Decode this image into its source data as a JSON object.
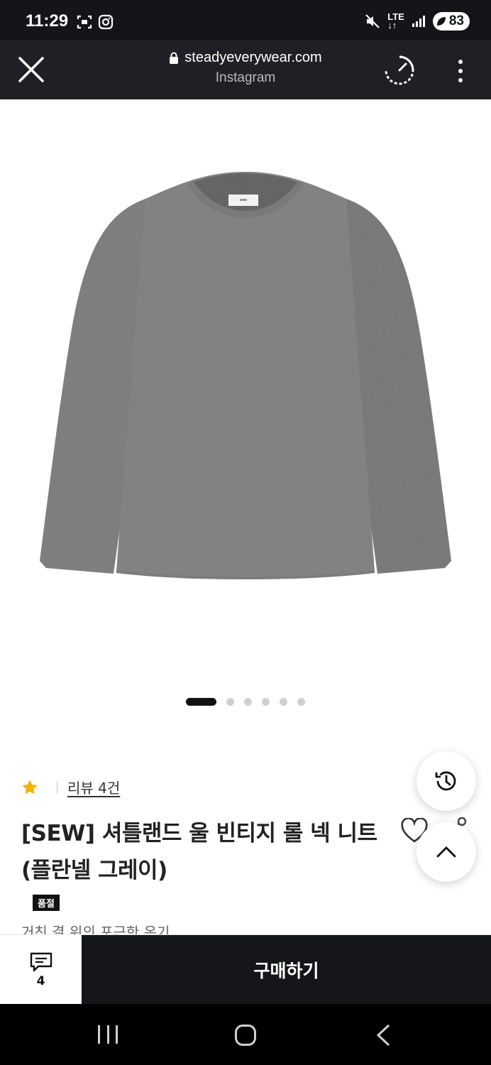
{
  "status_bar": {
    "time": "11:29",
    "network": "LTE",
    "battery": "83"
  },
  "browser": {
    "url": "steadyeverywear.com",
    "source": "Instagram"
  },
  "carousel": {
    "total": 6,
    "active_index": 0
  },
  "product": {
    "rating_stars": 1,
    "review_link": "리뷰 4건",
    "title": "[SEW] 셔틀랜드 울 빈티지 롤 넥 니트 (플란넬 그레이)",
    "badge": "품절",
    "subtext": "거친 결 위의 포근한 온기"
  },
  "bottom_bar": {
    "comment_count": "4",
    "buy_label": "구매하기"
  },
  "icons": {
    "close": "close-icon",
    "lock": "lock-icon",
    "speed": "speed-icon",
    "menu": "more-vert-icon",
    "star": "star-icon",
    "heart": "heart-icon",
    "share": "share-icon",
    "history": "history-icon",
    "up": "chevron-up-icon",
    "comment": "comment-icon"
  },
  "colors": {
    "star": "#f5b301",
    "buy_button": "#15161a",
    "status_bar": "#141519"
  }
}
